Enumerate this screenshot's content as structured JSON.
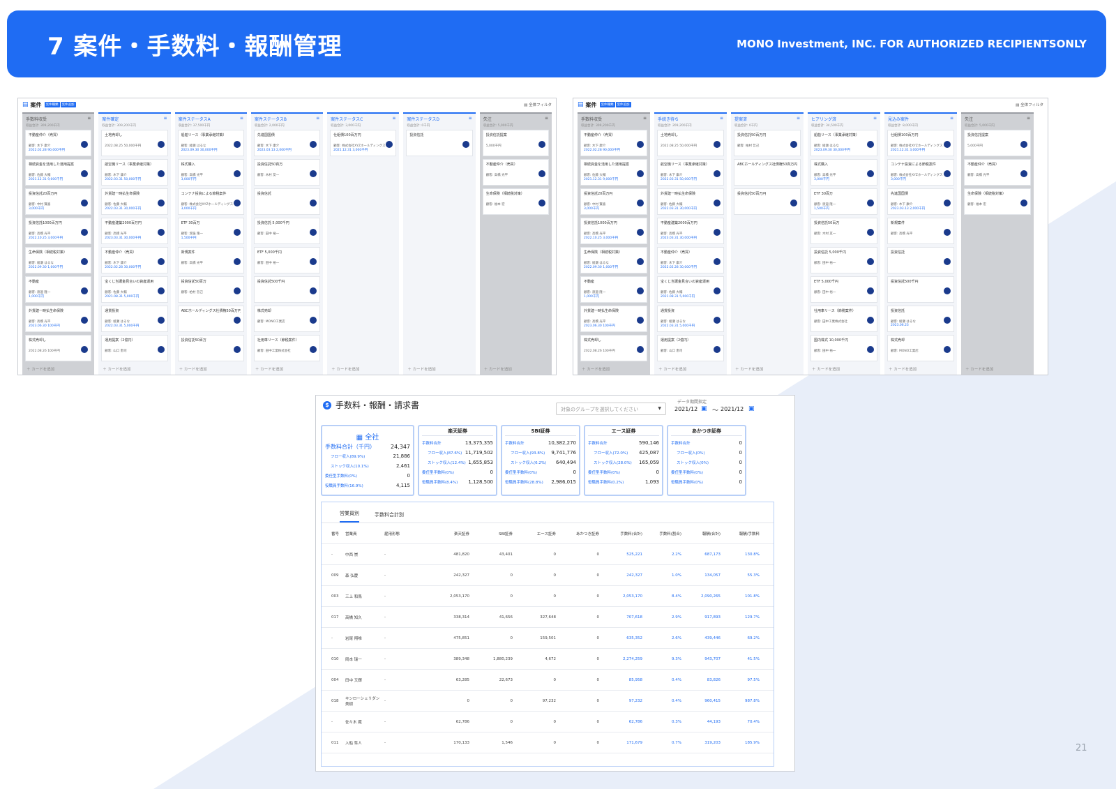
{
  "header": {
    "title": "7 案件・手数料・報酬管理",
    "confidential": "MONO Investment, INC. FOR AUTHORIZED RECIPIENTSONLY"
  },
  "board_left": {
    "title": "案件",
    "tags": [
      "案件種類",
      "案件追加"
    ],
    "filter": "全体フィルタ",
    "add_label": "＋ カードを追加",
    "columns": [
      {
        "name": "手数料収受",
        "sum": "収益合計: 309,200千円",
        "gray": true,
        "cards": [
          {
            "title": "不動産仲介（売買）",
            "line": "顧客: 木下 康介",
            "line2": "2022.02.28 90,000千円"
          },
          {
            "title": "相続資金を活用した運用提案",
            "line": "顧客: 佐藤 大輔",
            "line2": "2021.12.31 9,000千円"
          },
          {
            "title": "投資信託20百万円",
            "line": "顧客: 中村 賢喜",
            "line2": "3,000千円"
          },
          {
            "title": "投資信託1000百万円",
            "line": "顧客: 高橋 光平",
            "line2": "2022.10.25 3,000千円"
          },
          {
            "title": "生命保険（相続税対策）",
            "line": "顧客: 綾瀬 はるな",
            "line2": "2022.09.30 1,000千円"
          },
          {
            "title": "不動産",
            "line": "顧客: 渡邉 隆一",
            "line2": "1,000千円"
          },
          {
            "title": "外貨建一時払生命保険",
            "line": "顧客: 高橋 光平",
            "line2": "2023.06.30 100千円"
          },
          {
            "title": "株式売却し",
            "line": "2022.08.26 100千円",
            "line2": ""
          }
        ]
      },
      {
        "name": "案件確定",
        "sum": "収益合計: 309,200千円",
        "gray": false,
        "cards": [
          {
            "title": "土地売却し",
            "line": "2022.08.25 50,000千円",
            "line2": ""
          },
          {
            "title": "航空機リース（事業承継対策）",
            "line": "顧客: 木下 康介",
            "line2": "2022.03.31 50,000千円"
          },
          {
            "title": "外貨建一時払生命保険",
            "line": "顧客: 佐藤 大輔",
            "line2": "2022.03.31 30,000千円"
          },
          {
            "title": "不動産建築2000百万円",
            "line": "顧客: 高橋 光平",
            "line2": "2023.03.31 30,000千円"
          },
          {
            "title": "不動産仲介（売買）",
            "line": "顧客: 木下 康介",
            "line2": "2022.02.28 30,000千円"
          },
          {
            "title": "宝くじ当選金見合いの資産運用",
            "line": "顧客: 佐藤 大輔",
            "line2": "2021.08.31 5,000千円"
          },
          {
            "title": "通貨投資",
            "line": "顧客: 綾瀬 はるな",
            "line2": "2022.03.31 5,000千円"
          },
          {
            "title": "運用提案（2億円）",
            "line": "顧客: 山口 恵司",
            "line2": ""
          }
        ]
      },
      {
        "name": "案件ステータスA",
        "sum": "収益合計: 37,500千円",
        "gray": false,
        "cards": [
          {
            "title": "船舶リース（事業承継対策）",
            "line": "顧客: 綾瀬 はるな",
            "line2": "2023.09.30 30,000千円"
          },
          {
            "title": "株式購入",
            "line": "顧客: 高橋 光平",
            "line2": "3,000千円"
          },
          {
            "title": "コンテナ投資による節税案件",
            "line": "顧客: 株式会社XYZホールディングス",
            "line2": "3,000千円"
          },
          {
            "title": "ETF 30百万",
            "line": "顧客: 渡邉 隆一",
            "line2": "1,500千円"
          },
          {
            "title": "新規案件",
            "line": "顧客: 高橋 光平",
            "line2": ""
          },
          {
            "title": "投資信託50百万",
            "line": "顧客: 柏村 哲己",
            "line2": ""
          },
          {
            "title": "ABCホールディングス社債権50百万円",
            "line": "",
            "line2": ""
          },
          {
            "title": "投資信託50百万",
            "line": "",
            "line2": ""
          }
        ]
      },
      {
        "name": "案件ステータスB",
        "sum": "収益合計: 2,000千円",
        "gray": false,
        "cards": [
          {
            "title": "先進国国債",
            "line": "顧客: 木下 康介",
            "line2": "2023.03.13 2,000千円"
          },
          {
            "title": "投資信託50百万",
            "line": "顧客: 木村 友一",
            "line2": ""
          },
          {
            "title": "投資信託",
            "line": "",
            "line2": ""
          },
          {
            "title": "投資信託 5,000千円",
            "line": "顧客: 田中 裕一",
            "line2": ""
          },
          {
            "title": "ETF 5,000千円",
            "line": "顧客: 田中 裕一",
            "line2": ""
          },
          {
            "title": "投資信託500千円",
            "line": "",
            "line2": ""
          },
          {
            "title": "株式売却",
            "line": "顧客: MONO工業店",
            "line2": ""
          },
          {
            "title": "社用車リース（節税案件）",
            "line": "顧客: 田中工業株式会社",
            "line2": ""
          }
        ]
      },
      {
        "name": "案件ステータスC",
        "sum": "収益合計: 3,000千円",
        "gray": false,
        "cards": [
          {
            "title": "仕組債100百万円",
            "line": "顧客: 株式会社XYZホールディングス",
            "line2": "2021.12.31 3,000千円"
          }
        ]
      },
      {
        "name": "案件ステータスD",
        "sum": "収益合計: 0千円",
        "gray": false,
        "cards": [
          {
            "title": "投資信託",
            "line": "",
            "line2": ""
          }
        ]
      },
      {
        "name": "失注",
        "sum": "収益合計: 5,000千円",
        "gray": true,
        "cards": [
          {
            "title": "投資信託提案",
            "line": "5,000千円",
            "line2": ""
          },
          {
            "title": "不動産仲介（売買）",
            "line": "顧客: 高橋 光平",
            "line2": ""
          },
          {
            "title": "生命保険（相続税対策）",
            "line": "顧客: 福本 宏",
            "line2": ""
          }
        ]
      }
    ]
  },
  "board_right": {
    "title": "案件",
    "tags": [
      "案件種類",
      "案件追加"
    ],
    "filter": "全体フィルタ",
    "add_label": "＋ カードを追加",
    "columns": [
      {
        "name": "手数料収受",
        "sum": "収益合計: 309,200千円",
        "gray": true,
        "cards": [
          {
            "title": "不動産仲介（売買）",
            "line": "顧客: 木下 康介",
            "line2": "2022.02.28 90,000千円"
          },
          {
            "title": "相続資金を活用した運用提案",
            "line": "顧客: 佐藤 大輔",
            "line2": "2021.12.31 9,000千円"
          },
          {
            "title": "投資信託20百万円",
            "line": "顧客: 中村 賢喜",
            "line2": "3,000千円"
          },
          {
            "title": "投資信託1000百万円",
            "line": "顧客: 高橋 光平",
            "line2": "2022.10.25 3,000千円"
          },
          {
            "title": "生命保険（相続税対策）",
            "line": "顧客: 綾瀬 はるな",
            "line2": "2022.09.30 1,000千円"
          },
          {
            "title": "不動産",
            "line": "顧客: 渡邉 隆一",
            "line2": "1,000千円"
          },
          {
            "title": "外貨建一時払生命保険",
            "line": "顧客: 高橋 光平",
            "line2": "2023.06.30 100千円"
          },
          {
            "title": "株式売却し",
            "line": "2022.08.26 100千円",
            "line2": ""
          }
        ]
      },
      {
        "name": "手続き待ち",
        "sum": "収益合計: 209,200千円",
        "gray": false,
        "cards": [
          {
            "title": "土地売却し",
            "line": "2022.08.25 50,000千円",
            "line2": ""
          },
          {
            "title": "航空機リース（事業承継対策）",
            "line": "顧客: 木下 康介",
            "line2": "2022.03.31 50,000千円"
          },
          {
            "title": "外貨建一時払生命保険",
            "line": "顧客: 佐藤 大輔",
            "line2": "2022.03.31 30,000千円"
          },
          {
            "title": "不動産建築2000百万円",
            "line": "顧客: 高橋 光平",
            "line2": "2023.03.31 30,000千円"
          },
          {
            "title": "不動産仲介（売買）",
            "line": "顧客: 木下 康介",
            "line2": "2022.02.28 30,000千円"
          },
          {
            "title": "宝くじ当選金見合いの資産運用",
            "line": "顧客: 佐藤 大輔",
            "line2": "2021.08.31 5,000千円"
          },
          {
            "title": "通貨投資",
            "line": "顧客: 綾瀬 はるな",
            "line2": "2022.03.31 5,000千円"
          },
          {
            "title": "運用提案（2億円）",
            "line": "顧客: 山口 恵司",
            "line2": ""
          }
        ]
      },
      {
        "name": "提案済",
        "sum": "収益合計: 0千円",
        "gray": false,
        "cards": [
          {
            "title": "投資信託50百万円",
            "line": "顧客: 柏村 哲己",
            "line2": ""
          },
          {
            "title": "ABCホールディングス社債権50百万円",
            "line": "",
            "line2": ""
          },
          {
            "title": "投資信託50百万円",
            "line": "",
            "line2": ""
          }
        ]
      },
      {
        "name": "ヒアリング済",
        "sum": "収益合計: 34,500千円",
        "gray": false,
        "cards": [
          {
            "title": "船舶リース（事業承継対策）",
            "line": "顧客: 綾瀬 はるな",
            "line2": "2023.09.30 30,000千円"
          },
          {
            "title": "株式購入",
            "line": "顧客: 高橋 光平",
            "line2": "3,000千円"
          },
          {
            "title": "ETF 30百万",
            "line": "顧客: 渡邉 隆一",
            "line2": "1,500千円"
          },
          {
            "title": "投資信託50百万",
            "line": "顧客: 木村 友一",
            "line2": ""
          },
          {
            "title": "投資信託 5,000千円",
            "line": "顧客: 田中 裕一",
            "line2": ""
          },
          {
            "title": "ETF 5,000千円",
            "line": "顧客: 田中 裕一",
            "line2": ""
          },
          {
            "title": "社用車リース（節税案件）",
            "line": "顧客: 田中工業株式会社",
            "line2": ""
          },
          {
            "title": "国内株式 10,000千円",
            "line": "顧客: 田中 裕一",
            "line2": ""
          }
        ]
      },
      {
        "name": "見込み案件",
        "sum": "収益合計: 8,000千円",
        "gray": false,
        "cards": [
          {
            "title": "仕組債100百万円",
            "line": "顧客: 株式会社XYZホールディングス",
            "line2": "2021.12.31 3,000千円"
          },
          {
            "title": "コンテナ投資による節税案件",
            "line": "顧客: 株式会社XYZホールディングス",
            "line2": "3,000千円"
          },
          {
            "title": "先進国国債",
            "line": "顧客: 木下 康介",
            "line2": "2023.03.13 2,000千円"
          },
          {
            "title": "新規案件",
            "line": "顧客: 高橋 光平",
            "line2": ""
          },
          {
            "title": "投資信託",
            "line": "",
            "line2": ""
          },
          {
            "title": "投資信託500千円",
            "line": "",
            "line2": ""
          },
          {
            "title": "投資信託",
            "line": "顧客: 綾瀬 はるな",
            "line2": "2023.06.23"
          },
          {
            "title": "株式売却",
            "line": "顧客: MONO工業店",
            "line2": ""
          }
        ]
      },
      {
        "name": "失注",
        "sum": "収益合計: 5,000千円",
        "gray": true,
        "cards": [
          {
            "title": "投資信託提案",
            "line": "5,000千円",
            "line2": ""
          },
          {
            "title": "不動産仲介（売買）",
            "line": "顧客: 高橋 光平",
            "line2": ""
          },
          {
            "title": "生命保険（相続税対策）",
            "line": "顧客: 福本 宏",
            "line2": ""
          }
        ]
      }
    ]
  },
  "fee_panel": {
    "title": "手数料・報酬・請求書",
    "group_placeholder": "対象のグループを選択してください",
    "period_label": "データ期間指定",
    "date_from": "2021/12",
    "date_to": "2021/12",
    "tilde": "〜",
    "summary": [
      {
        "head": "全社",
        "rows": [
          {
            "label": "手数料合計（千円）",
            "value": "24,347"
          },
          {
            "label": "フロー収入(89.9%)",
            "value": "21,886"
          },
          {
            "label": "ストック収入(10.1%)",
            "value": "2,461"
          },
          {
            "label": "委任型手数料(0%)",
            "value": "0"
          },
          {
            "label": "役職員手数料(16.9%)",
            "value": "4,115"
          }
        ]
      },
      {
        "head": "楽天証券",
        "rows": [
          {
            "label": "手数料合計",
            "value": "13,375,355"
          },
          {
            "label": "フロー収入(87.6%)",
            "value": "11,719,502"
          },
          {
            "label": "ストック収入(12.4%)",
            "value": "1,655,853"
          },
          {
            "label": "委任型手数料(0%)",
            "value": "0"
          },
          {
            "label": "役職員手数料(8.4%)",
            "value": "1,128,500"
          }
        ]
      },
      {
        "head": "SBI証券",
        "rows": [
          {
            "label": "手数料合計",
            "value": "10,382,270"
          },
          {
            "label": "フロー収入(93.8%)",
            "value": "9,741,776"
          },
          {
            "label": "ストック収入(6.2%)",
            "value": "640,494"
          },
          {
            "label": "委任型手数料(0%)",
            "value": "0"
          },
          {
            "label": "役職員手数料(28.8%)",
            "value": "2,986,015"
          }
        ]
      },
      {
        "head": "エース証券",
        "rows": [
          {
            "label": "手数料合計",
            "value": "590,146"
          },
          {
            "label": "フロー収入(72.0%)",
            "value": "425,087"
          },
          {
            "label": "ストック収入(28.0%)",
            "value": "165,059"
          },
          {
            "label": "委任型手数料(0%)",
            "value": "0"
          },
          {
            "label": "役職員手数料(0.2%)",
            "value": "1,093"
          }
        ]
      },
      {
        "head": "あかつき証券",
        "rows": [
          {
            "label": "手数料合計",
            "value": "0"
          },
          {
            "label": "フロー収入(0%)",
            "value": "0"
          },
          {
            "label": "ストック収入(0%)",
            "value": "0"
          },
          {
            "label": "委任型手数料(0%)",
            "value": "0"
          },
          {
            "label": "役職員手数料(0%)",
            "value": "0"
          }
        ]
      }
    ],
    "tabs": [
      "営業員別",
      "手数料合計別"
    ],
    "columns": [
      "番号",
      "営業員",
      "雇用形態",
      "楽天証券",
      "SBI証券",
      "エース証券",
      "あかつき証券",
      "手数料(合計)",
      "手数料(割合)",
      "報酬(合計)",
      "報酬/手数料"
    ],
    "rows": [
      [
        "-",
        "中西 崇",
        "-",
        "481,820",
        "43,401",
        "0",
        "0",
        "525,221",
        "2.2%",
        "687,173",
        "130.8%"
      ],
      [
        "009",
        "森 弘慶",
        "-",
        "242,327",
        "0",
        "0",
        "0",
        "242,327",
        "1.0%",
        "134,057",
        "55.3%"
      ],
      [
        "003",
        "三上 和馬",
        "-",
        "2,053,170",
        "0",
        "0",
        "0",
        "2,053,170",
        "8.4%",
        "2,090,265",
        "101.8%"
      ],
      [
        "017",
        "高橋 知久",
        "-",
        "338,314",
        "41,656",
        "327,648",
        "0",
        "707,618",
        "2.9%",
        "917,893",
        "129.7%"
      ],
      [
        "-",
        "岩尾 翔唯",
        "-",
        "475,851",
        "0",
        "159,501",
        "0",
        "635,352",
        "2.6%",
        "439,446",
        "69.2%"
      ],
      [
        "010",
        "岡本 瑞一",
        "-",
        "389,348",
        "1,880,239",
        "4,672",
        "0",
        "2,274,259",
        "9.3%",
        "943,707",
        "41.5%"
      ],
      [
        "004",
        "田中 又輝",
        "-",
        "63,285",
        "22,673",
        "0",
        "0",
        "85,958",
        "0.4%",
        "83,826",
        "97.5%"
      ],
      [
        "018",
        "キンローシェリダン 美樹",
        "-",
        "0",
        "0",
        "97,232",
        "0",
        "97,232",
        "0.4%",
        "960,415",
        "987.8%"
      ],
      [
        "-",
        "佐々木 蔵",
        "-",
        "62,786",
        "0",
        "0",
        "0",
        "62,786",
        "0.3%",
        "44,193",
        "70.4%"
      ],
      [
        "011",
        "入船 隼人",
        "-",
        "170,133",
        "1,546",
        "0",
        "0",
        "171,679",
        "0.7%",
        "319,203",
        "185.9%"
      ]
    ]
  },
  "page_number": "21",
  "colors": {
    "accent": "#1f6cf3",
    "navy": "#1a3a8c",
    "bg_shape": "#e8eef9"
  }
}
